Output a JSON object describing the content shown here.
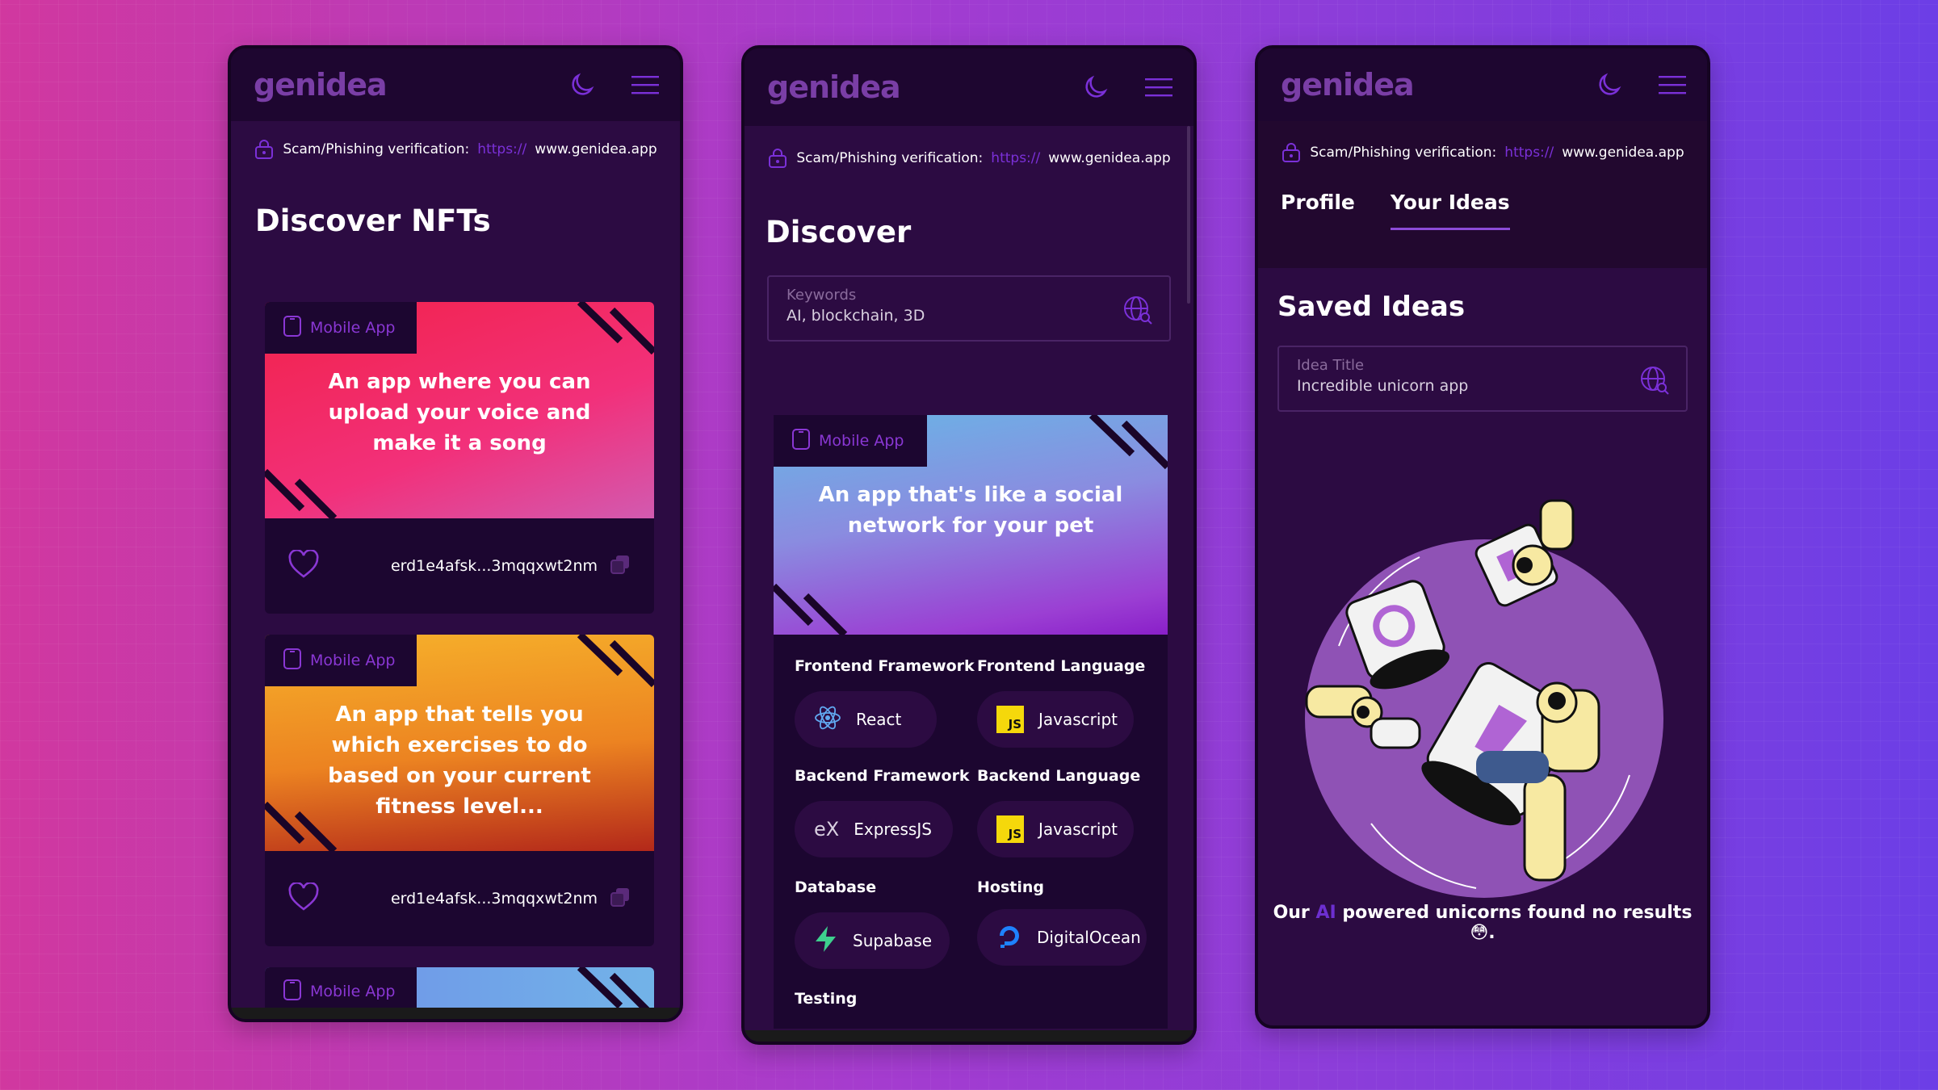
{
  "brand": {
    "logo": "genidea",
    "accent": "#7b30d8"
  },
  "verification": {
    "label": "Scam/Phishing verification:",
    "protocol": "https://",
    "domain": "www.genidea.app"
  },
  "discover_nfts": {
    "title": "Discover NFTs",
    "cards": [
      {
        "tag": "Mobile App",
        "text": "An app where you can upload your voice and make it a song",
        "wallet": "erd1e4afsk...3mqqxwt2nm",
        "gradient": [
          "#f2224a",
          "#f2307a",
          "#d25ab0"
        ]
      },
      {
        "tag": "Mobile App",
        "text": "An app that tells you which exercises to do based on your current fitness level...",
        "wallet": "erd1e4afsk...3mqqxwt2nm",
        "gradient": [
          "#f6b12b",
          "#ec8321",
          "#b3281a"
        ]
      },
      {
        "tag": "Mobile App",
        "text": "",
        "wallet": "",
        "gradient": [
          "#6e8ee8",
          "#72b3e8"
        ]
      }
    ]
  },
  "discover": {
    "title": "Discover",
    "search": {
      "label": "Keywords",
      "value": "AI, blockchain, 3D"
    },
    "card": {
      "tag": "Mobile App",
      "text": "An app that's like a social network for your pet",
      "stack": {
        "frontend_framework": {
          "label": "Frontend Framework",
          "value": "React"
        },
        "frontend_language": {
          "label": "Frontend Language",
          "value": "Javascript"
        },
        "backend_framework": {
          "label": "Backend Framework",
          "value": "ExpressJS"
        },
        "backend_language": {
          "label": "Backend Language",
          "value": "Javascript"
        },
        "database": {
          "label": "Database",
          "value": "Supabase"
        },
        "hosting": {
          "label": "Hosting",
          "value": "DigitalOcean"
        },
        "testing": {
          "label": "Testing"
        }
      }
    }
  },
  "profile": {
    "tabs": [
      "Profile",
      "Your Ideas"
    ],
    "active_tab": "Your Ideas",
    "saved_title": "Saved Ideas",
    "input": {
      "label": "Idea Title",
      "value": "Incredible unicorn app"
    },
    "empty_message": {
      "before": "Our ",
      "ai": "AI",
      "after": " powered unicorns found no results",
      "emoji": "😳",
      "end": "."
    }
  }
}
